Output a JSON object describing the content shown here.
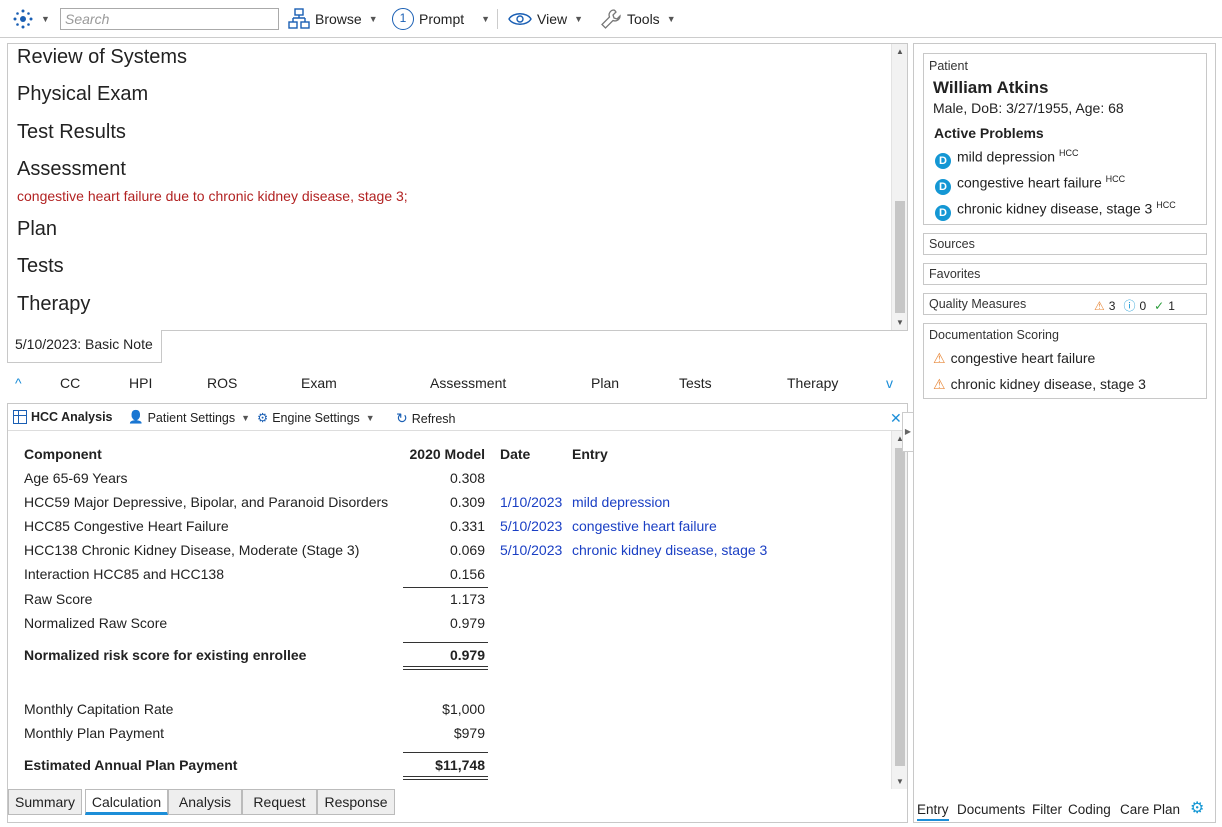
{
  "toolbar": {
    "search_placeholder": "Search",
    "browse": "Browse",
    "prompt": "Prompt",
    "prompt_badge": "1",
    "view": "View",
    "tools": "Tools"
  },
  "note": {
    "sections": [
      "Review of Systems",
      "Physical Exam",
      "Test Results",
      "Assessment",
      "Plan",
      "Tests",
      "Therapy"
    ],
    "assessment_text": "congestive heart failure due to chronic kidney disease, stage 3;",
    "tab_label": "5/10/2023: Basic Note"
  },
  "section_nav": [
    "CC",
    "HPI",
    "ROS",
    "Exam",
    "Assessment",
    "Plan",
    "Tests",
    "Therapy"
  ],
  "hcc": {
    "title": "HCC Analysis",
    "patient_settings": "Patient Settings",
    "engine_settings": "Engine Settings",
    "refresh": "Refresh",
    "headers": {
      "component": "Component",
      "model": "2020 Model",
      "date": "Date",
      "entry": "Entry"
    },
    "rows": [
      {
        "component": "Age 65-69 Years",
        "value": "0.308",
        "date": "",
        "entry": ""
      },
      {
        "component": "HCC59 Major Depressive, Bipolar, and Paranoid Disorders",
        "value": "0.309",
        "date": "1/10/2023",
        "entry": "mild depression"
      },
      {
        "component": "HCC85 Congestive Heart Failure",
        "value": "0.331",
        "date": "5/10/2023",
        "entry": "congestive heart failure"
      },
      {
        "component": "HCC138 Chronic Kidney Disease, Moderate (Stage 3)",
        "value": "0.069",
        "date": "5/10/2023",
        "entry": "chronic kidney disease, stage 3"
      },
      {
        "component": "Interaction HCC85 and HCC138",
        "value": "0.156",
        "date": "",
        "entry": ""
      }
    ],
    "raw_score": {
      "label": "Raw Score",
      "value": "1.173"
    },
    "normalized_raw": {
      "label": "Normalized Raw Score",
      "value": "0.979"
    },
    "risk_score": {
      "label": "Normalized risk score for existing enrollee",
      "value": "0.979"
    },
    "capitation": {
      "label": "Monthly Capitation Rate",
      "value": "$1,000"
    },
    "plan_payment": {
      "label": "Monthly Plan Payment",
      "value": "$979"
    },
    "annual": {
      "label": "Estimated Annual Plan Payment",
      "value": "$11,748"
    },
    "tabs": [
      "Summary",
      "Calculation",
      "Analysis",
      "Request",
      "Response"
    ],
    "active_tab": "Calculation"
  },
  "patient": {
    "header": "Patient",
    "name": "William Atkins",
    "demographics": "Male, DoB: 3/27/1955, Age: 68",
    "problems_title": "Active Problems",
    "problems": [
      {
        "name": "mild depression",
        "tag": "HCC",
        "icon": "D"
      },
      {
        "name": "congestive heart failure",
        "tag": "HCC",
        "icon": "D"
      },
      {
        "name": "chronic kidney disease, stage 3",
        "tag": "HCC",
        "icon": "D"
      }
    ]
  },
  "right_panels": {
    "sources": "Sources",
    "favorites": "Favorites",
    "quality": {
      "label": "Quality Measures",
      "warn": "3",
      "info": "0",
      "ok": "1"
    },
    "scoring": {
      "label": "Documentation Scoring",
      "items": [
        "congestive heart failure",
        "chronic kidney disease, stage 3"
      ]
    }
  },
  "right_tabs": [
    "Entry",
    "Documents",
    "Filter",
    "Coding",
    "Care Plan"
  ],
  "colors": {
    "accent": "#1c8ed8",
    "link": "#1a3fc4",
    "assessment": "#b22222",
    "warning": "#e8883a"
  }
}
